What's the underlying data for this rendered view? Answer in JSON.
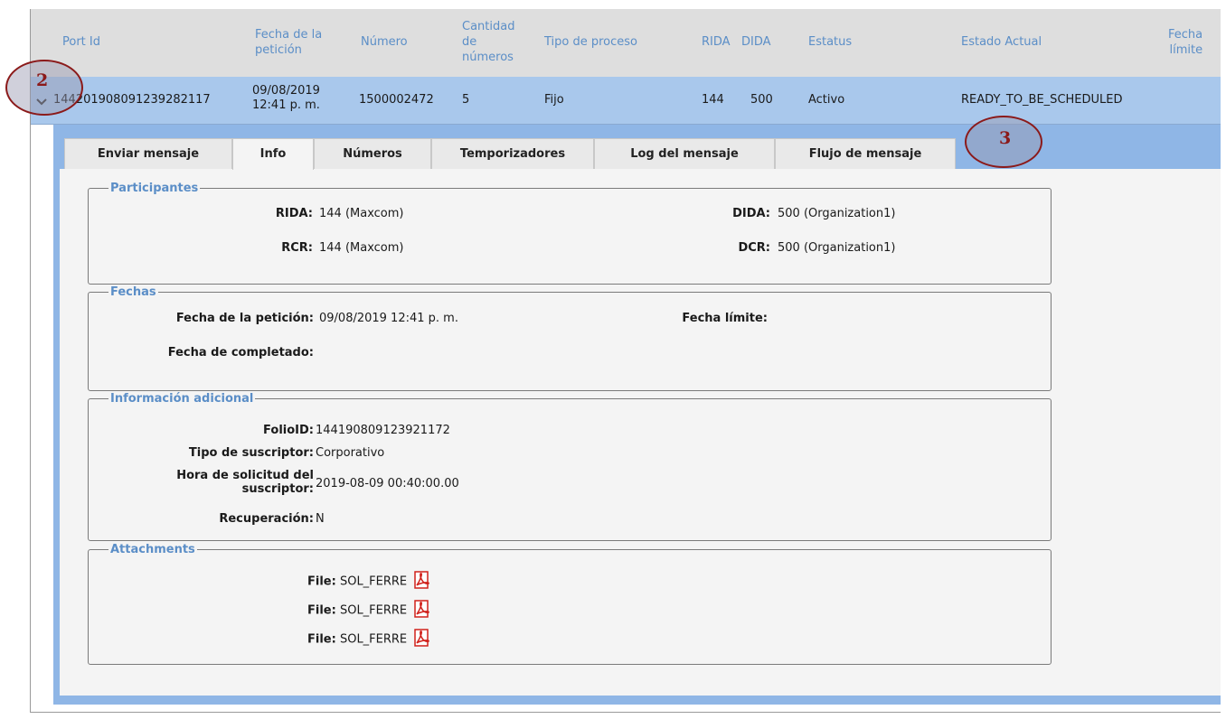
{
  "columns": {
    "port_id": "Port Id",
    "fecha_peticion": [
      "Fecha de la",
      "petición"
    ],
    "numero": "Número",
    "cantidad": [
      "Cantidad",
      "de",
      "números"
    ],
    "tipo_proceso": "Tipo de proceso",
    "rida": "RIDA",
    "dida": "DIDA",
    "estatus": "Estatus",
    "estado_actual": "Estado Actual",
    "fecha_limite": [
      "Fecha",
      "límite"
    ]
  },
  "row": {
    "port_id": "14420190809123928211​7",
    "fecha_line1": "09/08/2019",
    "fecha_line2": "12:41 p. m.",
    "numero": "1500002472",
    "cantidad": "5",
    "tipo_proceso": "Fijo",
    "rida": "144",
    "dida": "500",
    "estatus": "Activo",
    "estado_actual": "READY_TO_BE_SCHEDULED"
  },
  "tabs": [
    {
      "label": "Enviar mensaje"
    },
    {
      "label": "Info"
    },
    {
      "label": "Números"
    },
    {
      "label": "Temporizadores"
    },
    {
      "label": "Log del mensaje"
    },
    {
      "label": "Flujo de mensaje"
    }
  ],
  "participantes": {
    "legend": "Participantes",
    "rida_label": "RIDA:",
    "rida_value": "144 (Maxcom)",
    "dida_label": "DIDA:",
    "dida_value": "500 (Organization1)",
    "rcr_label": "RCR:",
    "rcr_value": "144 (Maxcom)",
    "dcr_label": "DCR:",
    "dcr_value": "500 (Organization1)"
  },
  "fechas": {
    "legend": "Fechas",
    "peticion_label": "Fecha de la petición:",
    "peticion_value": "09/08/2019 12:41 p. m.",
    "limite_label": "Fecha límite:",
    "completado_label": "Fecha de completado:"
  },
  "info_adicional": {
    "legend": "Información adicional",
    "folio_label": "FolioID:",
    "folio_value": "144190809123921172",
    "suscriptor_label": "Tipo de suscriptor:",
    "suscriptor_value": "Corporativo",
    "hora_label_1": "Hora de solicitud del",
    "hora_label_2": "suscriptor:",
    "hora_value": "2019-08-09 00:40:00.00",
    "recuperacion_label": "Recuperación:",
    "recuperacion_value": "N"
  },
  "attachments": {
    "legend": "Attachments",
    "file_label": "File:",
    "files": [
      "SOL_FERRE",
      "SOL_FERRE",
      "SOL_FERRE"
    ],
    "icon": "pdf-icon"
  },
  "markers": {
    "m2": "2",
    "m3": "3"
  },
  "colors": {
    "header_text": "#5b8ec7",
    "row_selected": "#a9c8ec",
    "panel_border": "#8fb6e6",
    "marker": "#8b1a1a",
    "pdf": "#d0211b"
  }
}
